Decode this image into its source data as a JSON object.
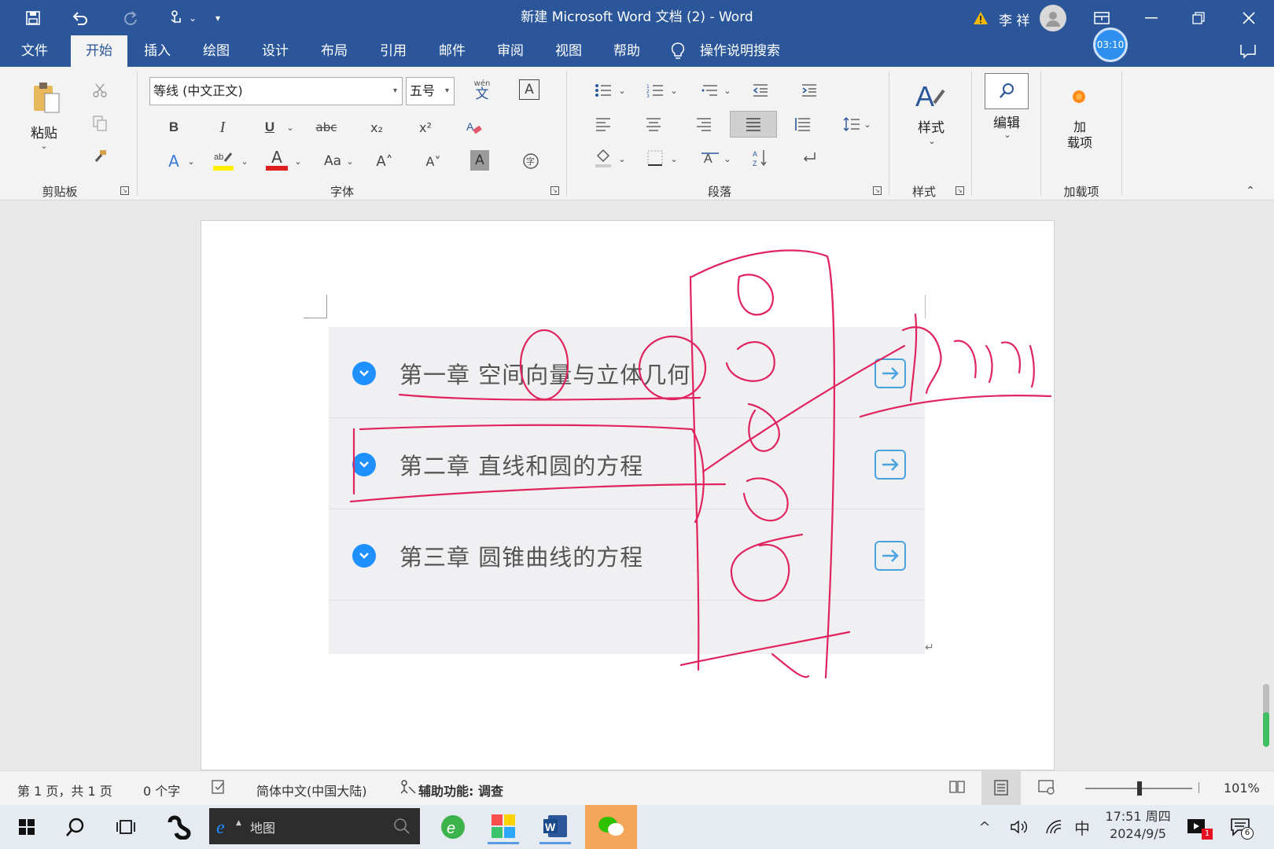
{
  "titlebar": {
    "title": "新建 Microsoft Word 文档 (2)  -  Word",
    "user_name": "李 祥",
    "timer": "03:10"
  },
  "menu": {
    "items": [
      "文件",
      "开始",
      "插入",
      "绘图",
      "设计",
      "布局",
      "引用",
      "邮件",
      "审阅",
      "视图",
      "帮助"
    ],
    "search_placeholder": "操作说明搜索"
  },
  "ribbon": {
    "clipboard": {
      "paste_label": "粘贴",
      "group_label": "剪贴板"
    },
    "font": {
      "font_name": "等线 (中文正文)",
      "font_size": "五号",
      "bold": "B",
      "italic": "I",
      "underline": "U",
      "strikethrough": "abc",
      "subscript": "x₂",
      "superscript": "x²",
      "font_color": "A",
      "change_case": "Aa",
      "grow": "A˄",
      "shrink": "A˅",
      "char_shading": "A",
      "phonetic": "wén",
      "group_label": "字体"
    },
    "paragraph": {
      "group_label": "段落"
    },
    "styles": {
      "label": "样式",
      "group_label": "样式"
    },
    "editing": {
      "label": "编辑"
    },
    "addins": {
      "label_line1": "加",
      "label_line2": "载项",
      "group_label": "加载项"
    }
  },
  "document": {
    "chapters": [
      {
        "text": "第一章 空间向量与立体几何"
      },
      {
        "text": "第二章 直线和圆的方程"
      },
      {
        "text": "第三章 圆锥曲线的方程"
      }
    ],
    "paragraph_mark": "↵"
  },
  "statusbar": {
    "page_info": "第 1 页，共 1 页",
    "word_count": "0 个字",
    "language": "简体中文(中国大陆)",
    "accessibility": "辅助功能: 调查",
    "zoom": "101%"
  },
  "taskbar": {
    "search_text": "地图",
    "ime": "中",
    "time": "17:51 周四",
    "date": "2024/9/5",
    "notif_badge": "6",
    "video_badge": "1"
  },
  "colors": {
    "brand": "#2b579a",
    "ink": "#e0245e",
    "accent": "#1e90ff"
  }
}
